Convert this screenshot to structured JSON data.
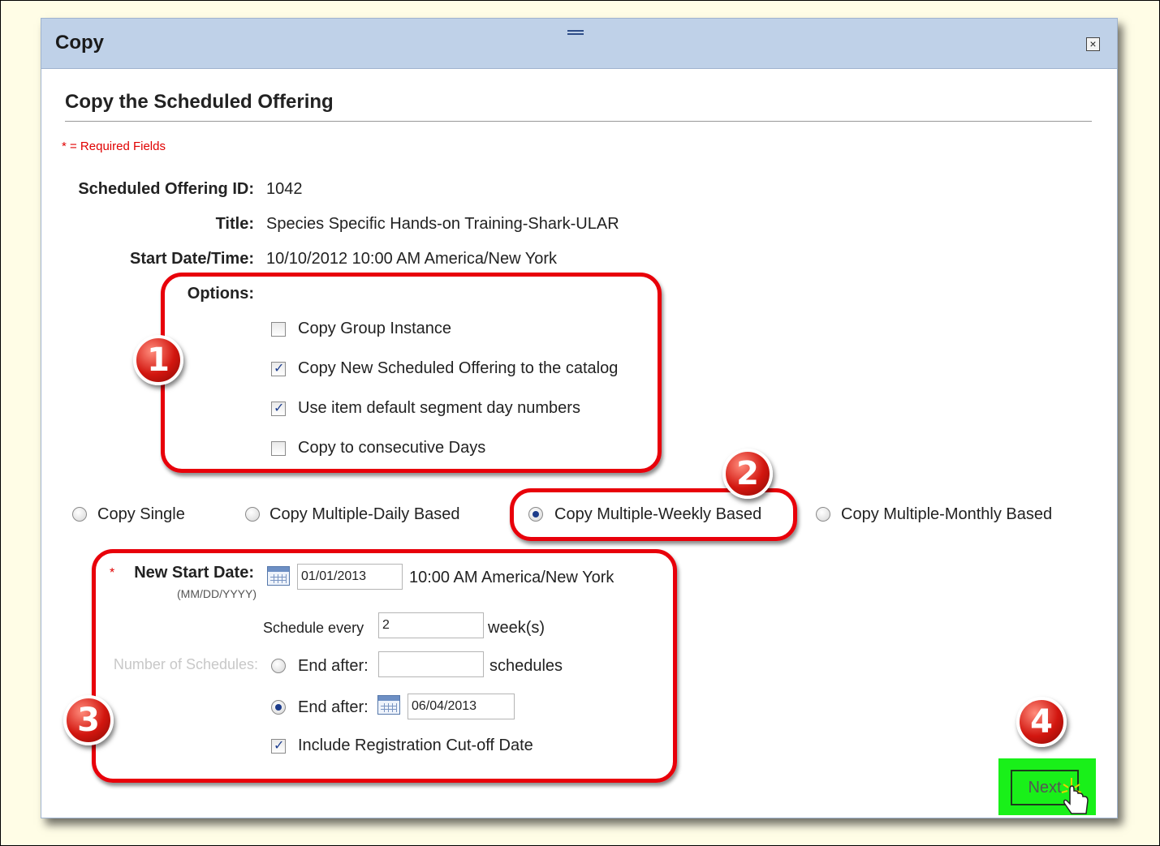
{
  "dialog": {
    "title": "Copy",
    "close_label": "×"
  },
  "form": {
    "heading": "Copy the Scheduled Offering",
    "required_note": "* = Required Fields",
    "fields": {
      "offering_id_label": "Scheduled Offering ID:",
      "offering_id_value": "1042",
      "title_label": "Title:",
      "title_value": "Species Specific Hands-on Training-Shark-ULAR",
      "start_label": "Start Date/Time:",
      "start_value": "10/10/2012 10:00 AM America/New York"
    },
    "options": {
      "label": "Options:",
      "items": [
        {
          "label": "Copy Group Instance",
          "checked": false
        },
        {
          "label": "Copy New Scheduled Offering to the catalog",
          "checked": true
        },
        {
          "label": "Use item default segment day numbers",
          "checked": true
        },
        {
          "label": "Copy to consecutive Days",
          "checked": false
        }
      ]
    },
    "copy_modes": [
      {
        "label": "Copy Single",
        "selected": false
      },
      {
        "label": "Copy Multiple-Daily Based",
        "selected": false
      },
      {
        "label": "Copy Multiple-Weekly Based",
        "selected": true
      },
      {
        "label": "Copy Multiple-Monthly Based",
        "selected": false
      }
    ],
    "schedule": {
      "required_star": "*",
      "new_start_label": "New Start Date:",
      "date_format": "(MM/DD/YYYY)",
      "new_start_value": "01/01/2013",
      "new_start_time": "10:00 AM America/New York",
      "schedule_every_label": "Schedule every",
      "schedule_every_value": "2",
      "schedule_every_unit": "week(s)",
      "number_label": "Number of Schedules:",
      "end_after_count_label": "End after:",
      "end_after_count_value": "",
      "end_after_count_unit": "schedules",
      "end_after_count_selected": false,
      "end_after_date_label": "End after:",
      "end_after_date_value": "06/04/2013",
      "end_after_date_selected": true,
      "include_cutoff_label": "Include Registration Cut-off Date",
      "include_cutoff_checked": true
    },
    "next_label": "Next"
  },
  "annotations": {
    "badges": [
      "1",
      "2",
      "3",
      "4"
    ],
    "callout_color": "#e8000a",
    "highlight_color": "#19f019"
  }
}
